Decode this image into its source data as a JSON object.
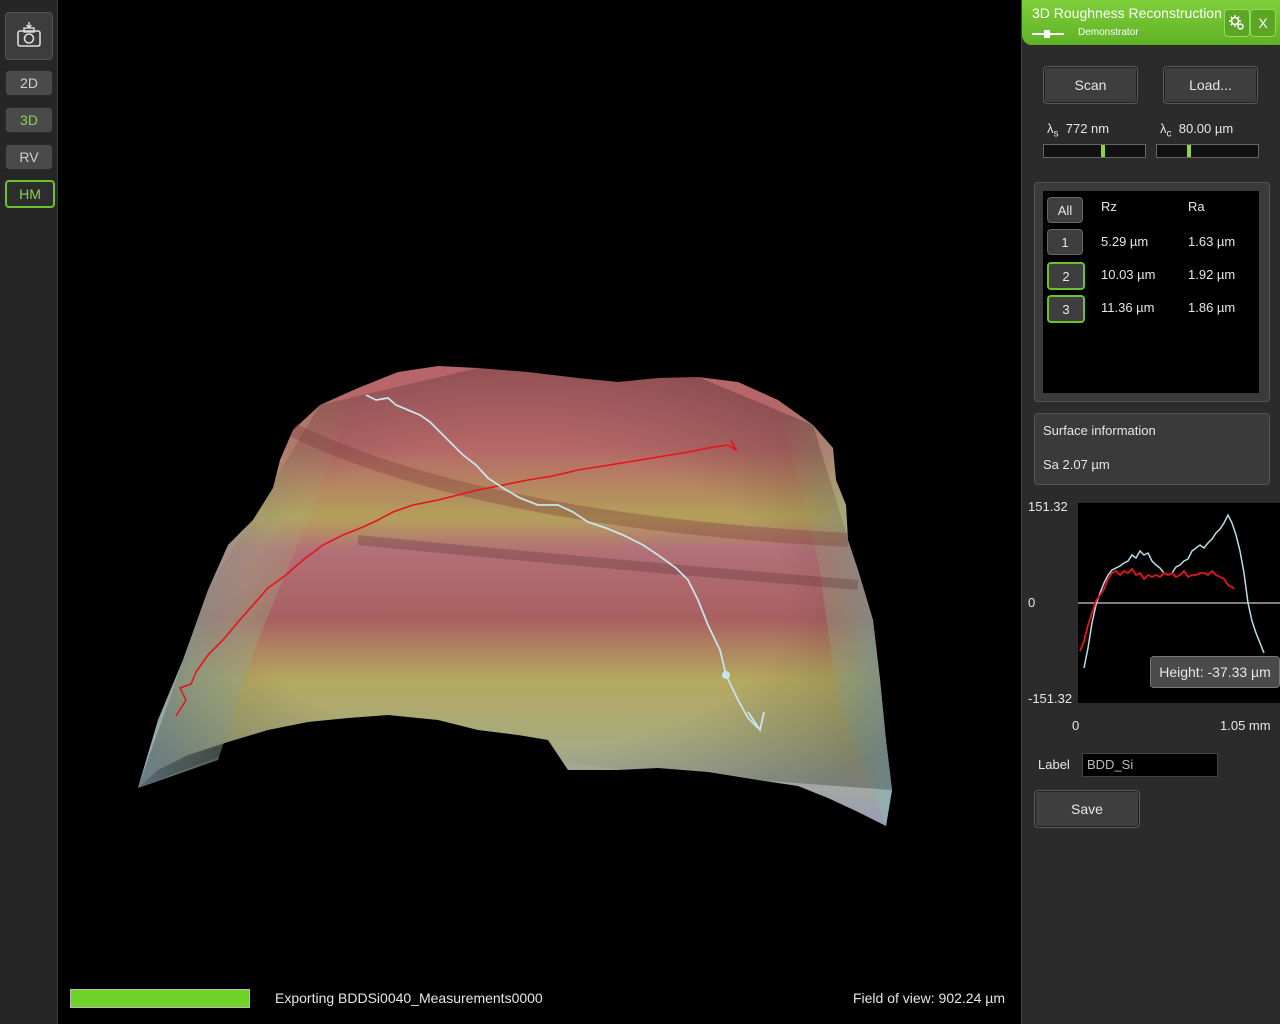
{
  "toolbar": {
    "camera_icon": "camera-icon",
    "buttons": [
      {
        "label": "2D"
      },
      {
        "label": "3D"
      },
      {
        "label": "RV"
      },
      {
        "label": "HM"
      }
    ]
  },
  "status": {
    "progress": 1.0,
    "export_text": "Exporting BDDSi0040_Measurements0000",
    "fov_text": "Field of view: 902.24 µm"
  },
  "panel": {
    "title": "3D Roughness Reconstruction",
    "subtitle": "Demonstrator",
    "settings_icon": "gears-icon",
    "close_label": "X",
    "scan_label": "Scan",
    "load_label": "Load...",
    "lambda_s": {
      "symbol": "λ",
      "sub": "s",
      "value": "772 nm",
      "level": 0.58
    },
    "lambda_c": {
      "symbol": "λ",
      "sub": "c",
      "value": "80.00 µm",
      "level": 0.32
    },
    "table": {
      "all_label": "All",
      "col_rz": "Rz",
      "col_ra": "Ra",
      "rows": [
        {
          "id": "1",
          "rz": "5.29 µm",
          "ra": "1.63 µm",
          "selected": false
        },
        {
          "id": "2",
          "rz": "10.03 µm",
          "ra": "1.92 µm",
          "selected": true
        },
        {
          "id": "3",
          "rz": "11.36 µm",
          "ra": "1.86 µm",
          "selected": true
        }
      ]
    },
    "surface": {
      "title": "Surface information",
      "sa": "Sa 2.07 µm"
    },
    "profile": {
      "y_max": "151.32",
      "y_zero": "0",
      "y_min": "-151.32",
      "x_min": "0",
      "x_max": "1.05 mm",
      "tooltip": "Height: -37.33 µm",
      "colors": {
        "series_1": "#e8141c",
        "series_2": "#b8dde8"
      }
    },
    "label_caption": "Label",
    "label_value": "BDD_Si",
    "save_label": "Save"
  },
  "colors": {
    "accent": "#6cc12f",
    "panel_bg": "#2b2b2b",
    "red_path": "#e8141c",
    "white_path": "#c8e4ec"
  }
}
